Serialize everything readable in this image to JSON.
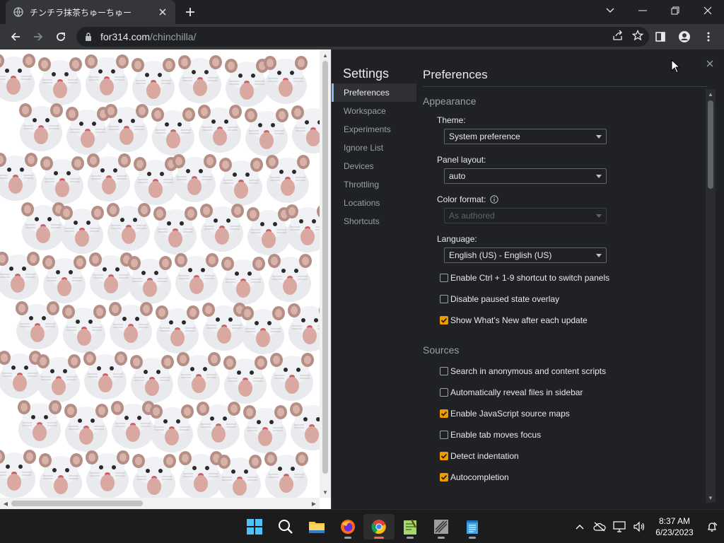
{
  "browser": {
    "tab_title": "チンチラ抹茶ちゅーちゅー",
    "url_host": "for314.com",
    "url_path": "/chinchilla/"
  },
  "devtools": {
    "settings_title": "Settings",
    "nav": [
      {
        "label": "Preferences",
        "selected": true
      },
      {
        "label": "Workspace",
        "selected": false
      },
      {
        "label": "Experiments",
        "selected": false
      },
      {
        "label": "Ignore List",
        "selected": false
      },
      {
        "label": "Devices",
        "selected": false
      },
      {
        "label": "Throttling",
        "selected": false
      },
      {
        "label": "Locations",
        "selected": false
      },
      {
        "label": "Shortcuts",
        "selected": false
      }
    ],
    "pane_title": "Preferences",
    "appearance": {
      "heading": "Appearance",
      "theme_label": "Theme:",
      "theme_value": "System preference",
      "panel_layout_label": "Panel layout:",
      "panel_layout_value": "auto",
      "color_format_label": "Color format:",
      "color_format_value": "As authored",
      "language_label": "Language:",
      "language_value": "English (US) - English (US)",
      "checkboxes": [
        {
          "label": "Enable Ctrl + 1-9 shortcut to switch panels",
          "checked": false
        },
        {
          "label": "Disable paused state overlay",
          "checked": false
        },
        {
          "label": "Show What's New after each update",
          "checked": true
        }
      ]
    },
    "sources": {
      "heading": "Sources",
      "checkboxes": [
        {
          "label": "Search in anonymous and content scripts",
          "checked": false
        },
        {
          "label": "Automatically reveal files in sidebar",
          "checked": false
        },
        {
          "label": "Enable JavaScript source maps",
          "checked": true
        },
        {
          "label": "Enable tab moves focus",
          "checked": false
        },
        {
          "label": "Detect indentation",
          "checked": true
        },
        {
          "label": "Autocompletion",
          "checked": true
        }
      ]
    }
  },
  "taskbar": {
    "time": "8:37 AM",
    "date": "6/23/2023"
  },
  "colors": {
    "checkbox_checked": "#f29900",
    "accent": "#8ab4f8"
  }
}
